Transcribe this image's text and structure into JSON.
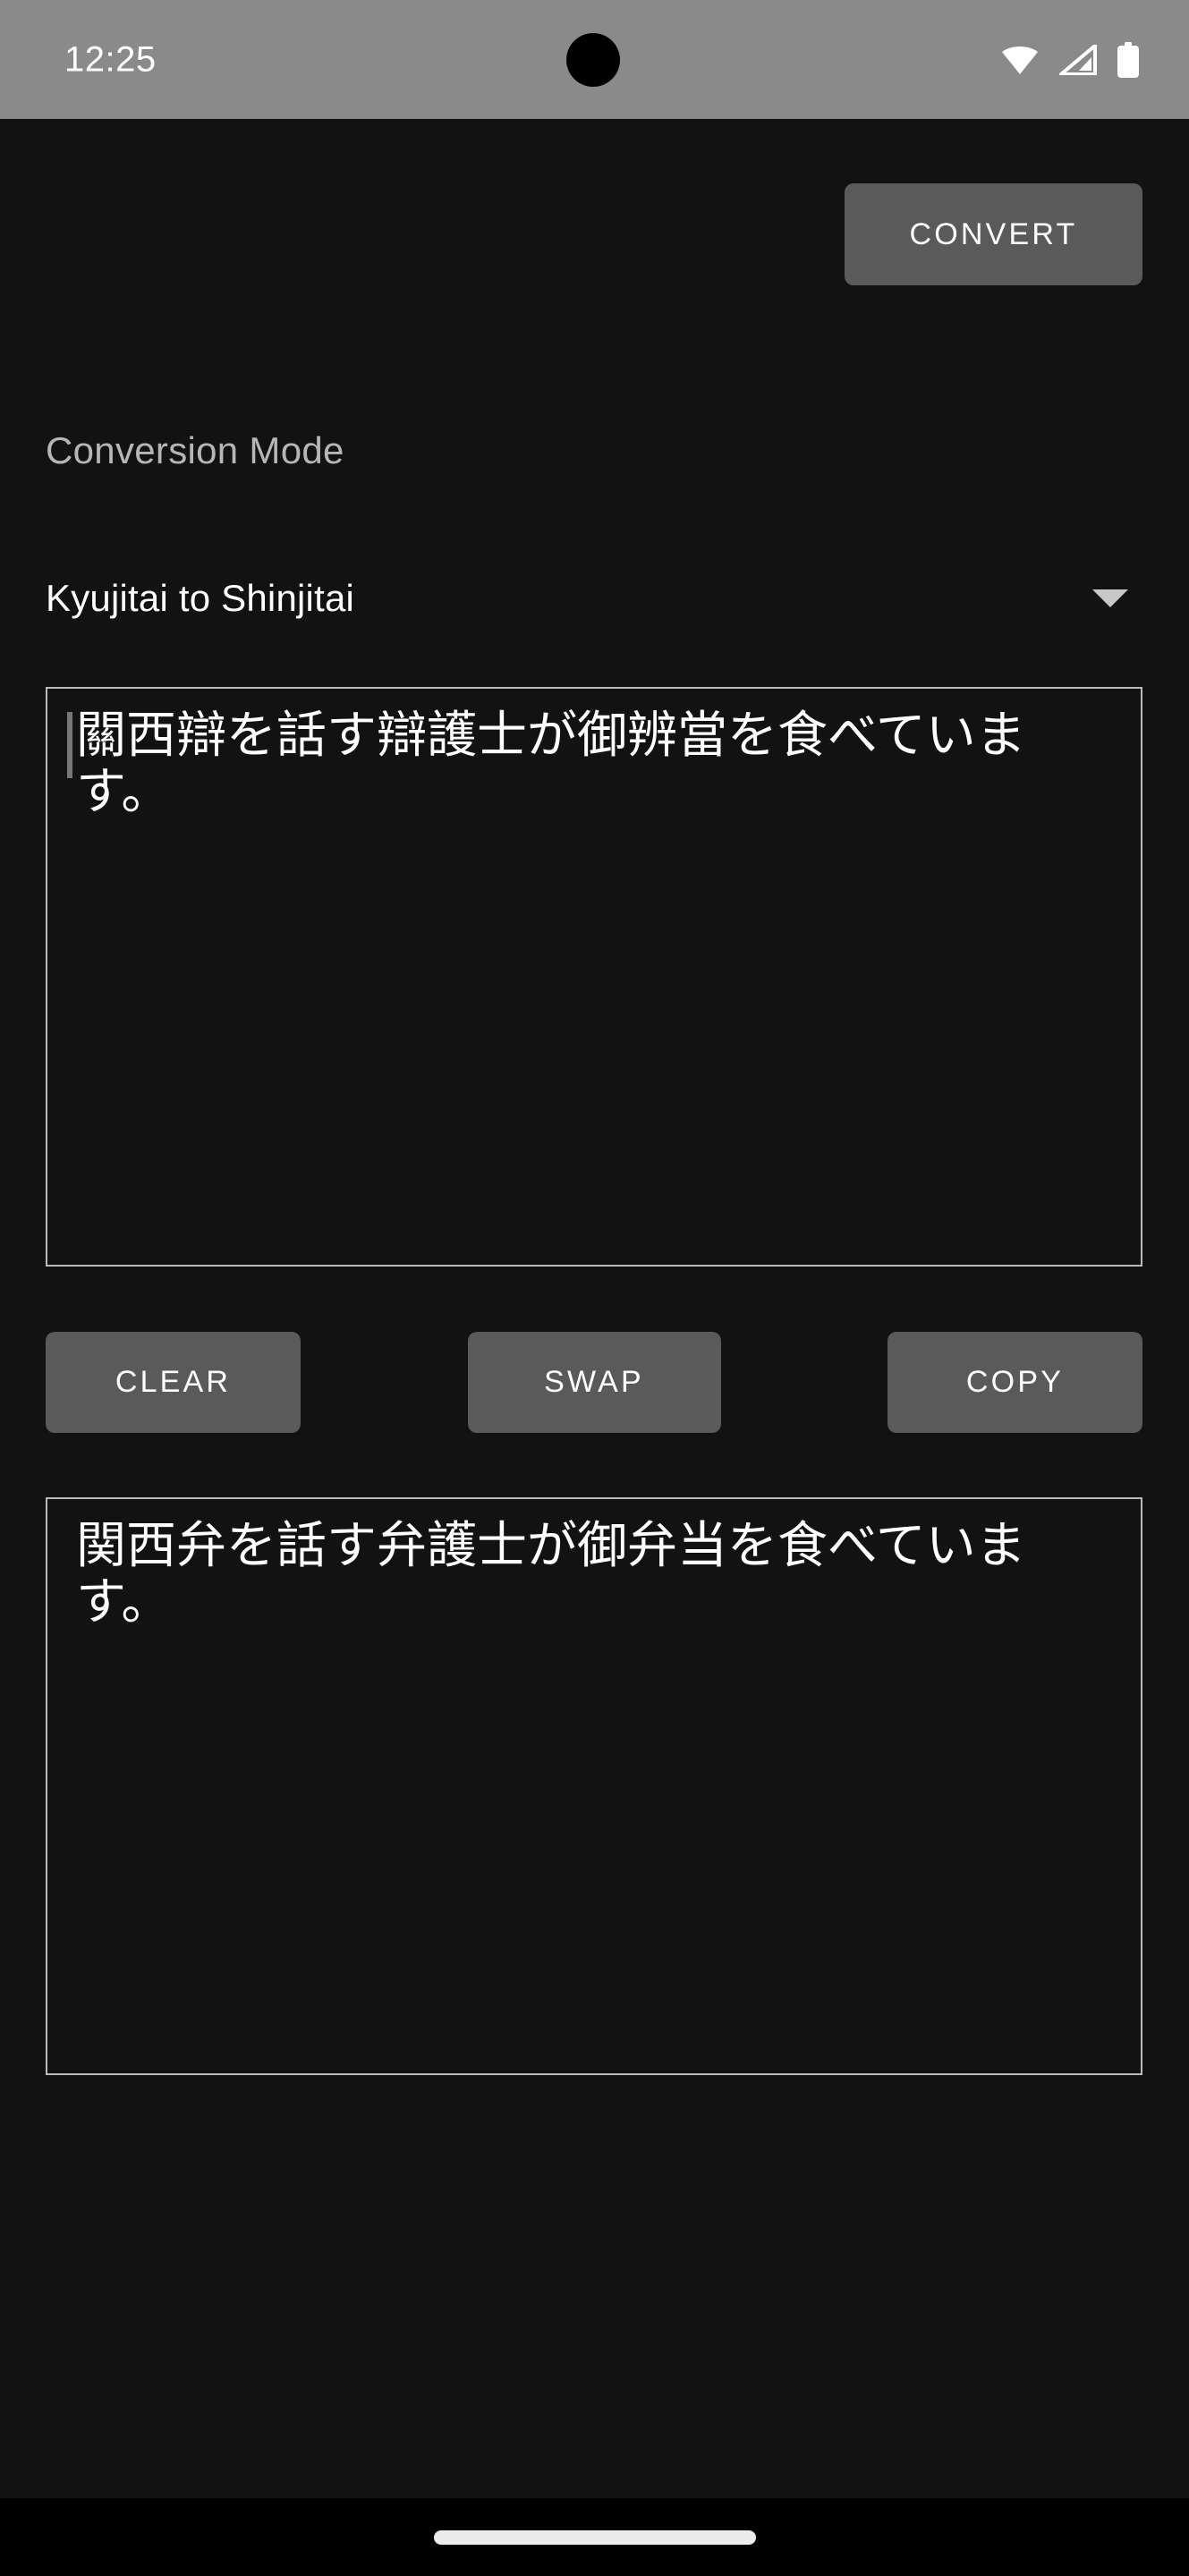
{
  "status_bar": {
    "clock": "12:25",
    "icons": [
      {
        "name": "wifi-icon",
        "label": "wifi"
      },
      {
        "name": "cellular-signal-icon",
        "label": "cellular"
      },
      {
        "name": "battery-icon",
        "label": "battery"
      }
    ],
    "background_color": "#8a8a8a",
    "text_color": "#ffffff"
  },
  "toolbar": {
    "convert_label": "CONVERT"
  },
  "mode": {
    "section_label": "Conversion Mode",
    "selected": "Kyujitai to Shinjitai",
    "caret_icon": "chevron-down-icon",
    "options": [
      "Kyujitai to Shinjitai"
    ]
  },
  "input": {
    "value": "關西辯を話す辯護士が御辨當を食べています。",
    "placeholder": ""
  },
  "output": {
    "value": "関西弁を話す弁護士が御弁当を食べています。",
    "placeholder": ""
  },
  "actions": {
    "clear_label": "CLEAR",
    "swap_label": "SWAP",
    "copy_label": "COPY"
  },
  "navigation": {
    "gesture_pill": ""
  },
  "colors": {
    "app_background": "#121212",
    "button_background": "#5a5a5a",
    "border": "#b9b9b9",
    "label_text": "#b6b6b6",
    "primary_text": "#ffffff",
    "nav_background": "#000000"
  }
}
